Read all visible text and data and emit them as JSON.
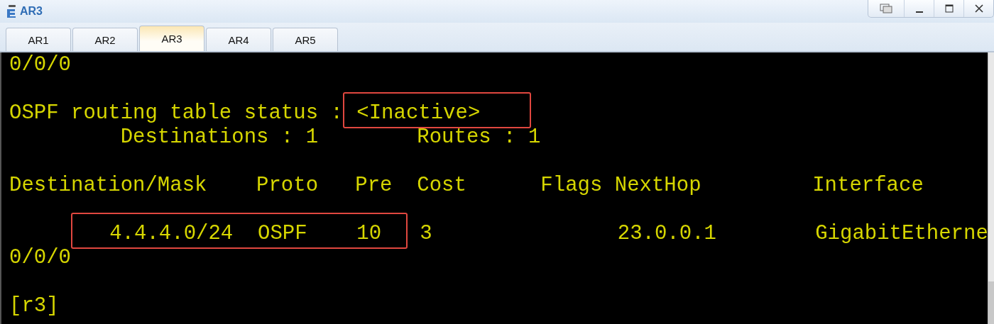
{
  "window": {
    "title": "AR3"
  },
  "tabs": [
    {
      "label": "AR1",
      "selected": false
    },
    {
      "label": "AR2",
      "selected": false
    },
    {
      "label": "AR3",
      "selected": true
    },
    {
      "label": "AR4",
      "selected": false
    },
    {
      "label": "AR5",
      "selected": false
    }
  ],
  "terminal": {
    "lines": [
      {
        "gap_before": false,
        "kind": "plain",
        "segments": [
          {
            "text": "0/0/0",
            "boxed": false
          }
        ]
      },
      {
        "gap_before": true,
        "kind": "plain",
        "segments": [
          {
            "text": "OSPF routing table status :",
            "boxed": false
          },
          {
            "text": " <Inactive>    ",
            "boxed": true
          }
        ]
      },
      {
        "gap_before": false,
        "kind": "plain",
        "segments": [
          {
            "text": "         Destinations : 1        Routes : 1",
            "boxed": false
          }
        ]
      },
      {
        "gap_before": true,
        "kind": "plain",
        "segments": [
          {
            "text": "Destination/Mask    Proto   Pre  Cost      Flags NextHop         Interface",
            "boxed": false
          }
        ]
      },
      {
        "gap_before": true,
        "kind": "indented",
        "segments": [
          {
            "text": "   4.4.4.0/24  OSPF    10  ",
            "boxed": true
          },
          {
            "text": " 3               23.0.0.1        GigabitEtherne",
            "boxed": false
          }
        ]
      },
      {
        "gap_before": false,
        "kind": "plain",
        "segments": [
          {
            "text": "0/0/0",
            "boxed": false
          }
        ]
      },
      {
        "gap_before": true,
        "kind": "plain",
        "segments": [
          {
            "text": "[r3]",
            "boxed": false
          }
        ]
      }
    ]
  }
}
